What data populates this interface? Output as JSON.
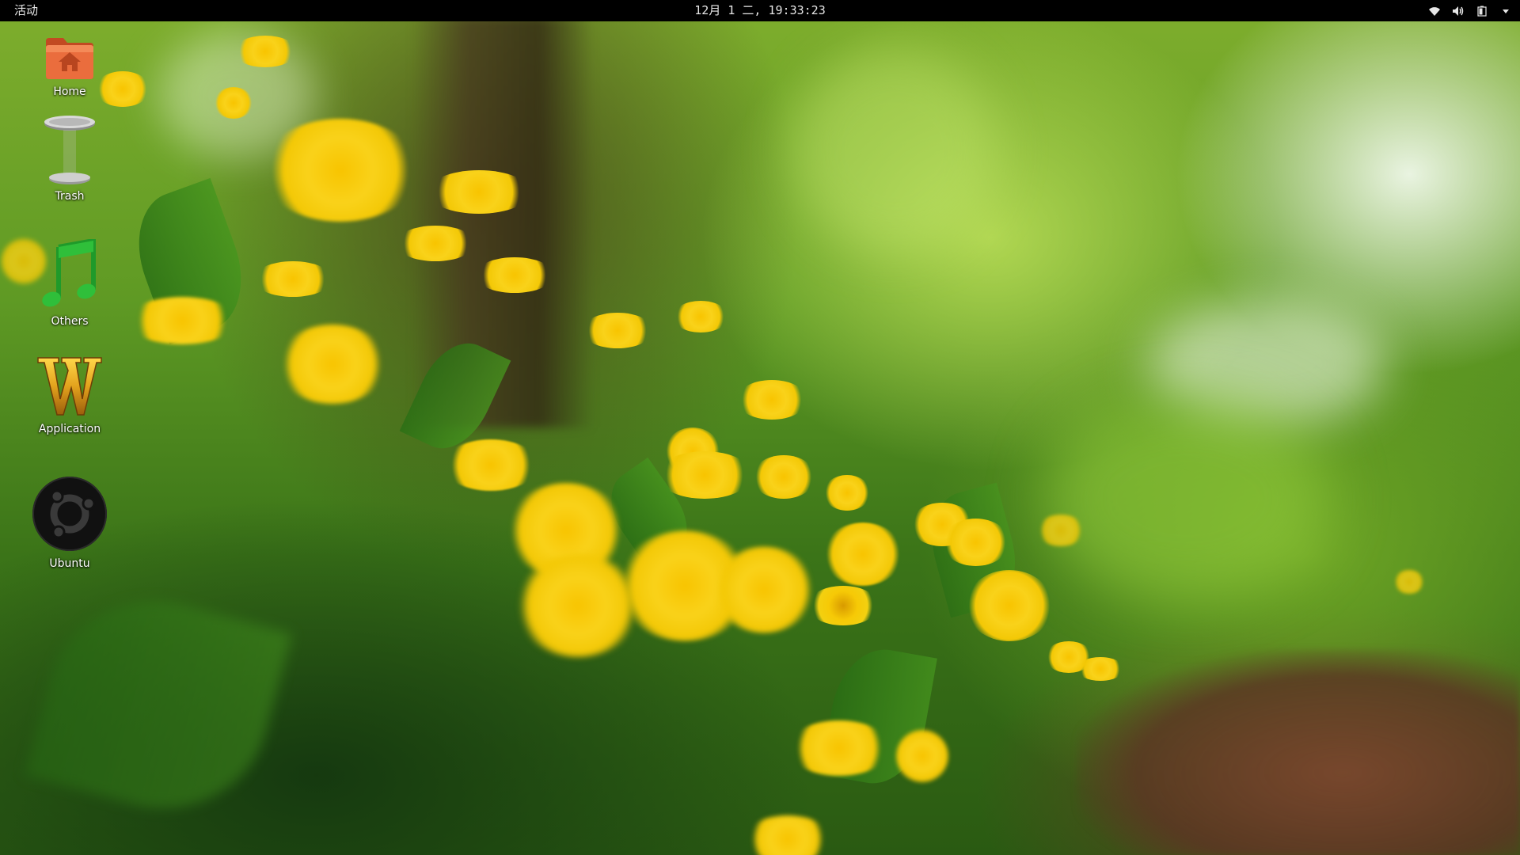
{
  "topbar": {
    "activities_label": "活动",
    "clock_text": "12月 1 二, 19:33:23",
    "status_icons": [
      "wifi-icon",
      "volume-icon",
      "battery-icon",
      "system-menu-arrow-icon"
    ]
  },
  "desktop": {
    "icons": [
      {
        "label": "Home",
        "icon": "home-folder-icon"
      },
      {
        "label": "Trash",
        "icon": "trash-icon"
      },
      {
        "label": "Others",
        "icon": "music-note-icon"
      },
      {
        "label": "Application",
        "icon": "w-logo-icon"
      },
      {
        "label": "Ubuntu",
        "icon": "ubuntu-logo-icon"
      }
    ]
  },
  "colors": {
    "topbar_bg": "#000000",
    "topbar_text": "#e6e6e6",
    "folder_orange": "#e8683a",
    "music_green": "#2fbf3a",
    "w_gold": "#e2a21d",
    "dandelion_yellow": "#f6cf0a"
  }
}
